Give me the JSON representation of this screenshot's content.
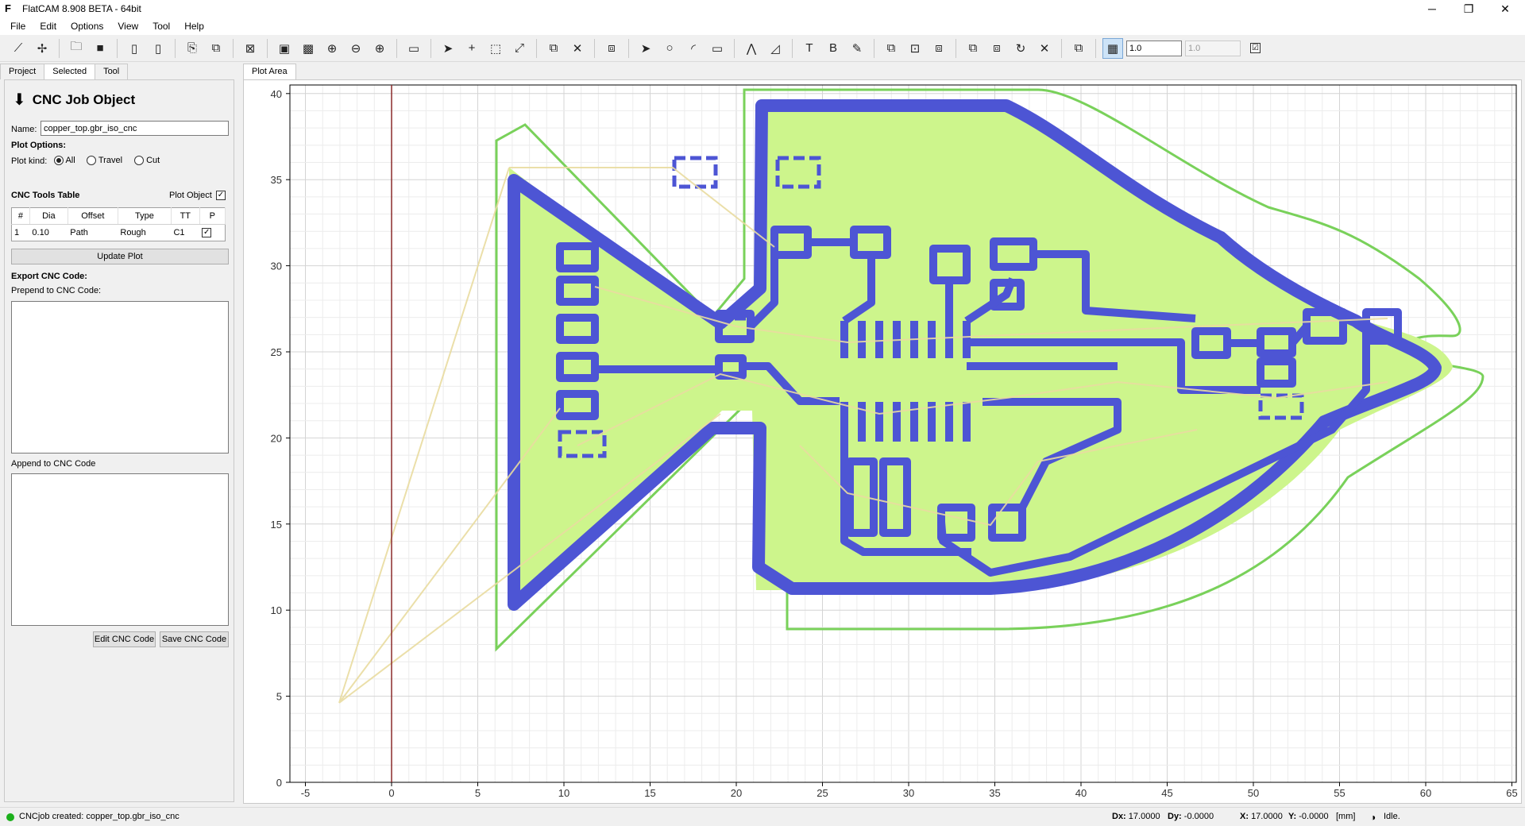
{
  "window": {
    "title": "FlatCAM 8.908 BETA - 64bit",
    "minimize": "─",
    "restore": "❐",
    "close": "✕"
  },
  "menu": [
    "File",
    "Edit",
    "Options",
    "View",
    "Tool",
    "Help"
  ],
  "toolbar": {
    "icons": [
      "new-geometry-icon",
      "add-point-icon",
      "open-folder-icon",
      "save-icon",
      "open-gerber-icon",
      "open-excellon-icon",
      "copy-icon",
      "delete-object-icon",
      "plot-all-icon",
      "clear-plot-icon",
      "zoom-fit-icon",
      "zoom-out-icon",
      "zoom-in-icon",
      "shell-icon",
      "select-icon",
      "add-icon",
      "bbox-icon",
      "move-icon",
      "duplicate-icon",
      "delete-icon",
      "join-icon",
      "pointer-icon",
      "circle-icon",
      "arc-icon",
      "rectangle-icon",
      "polygon-icon",
      "path-icon",
      "text-icon",
      "buffer-icon",
      "paint-icon",
      "union-icon",
      "intersect-icon",
      "subtract-icon",
      "cut-icon",
      "rotate-icon",
      "move-geo-icon",
      "delete-shape-icon",
      "copy-shape-icon",
      "grid-snap-icon"
    ],
    "grid_x": "1.0",
    "grid_y": "1.0",
    "snap_checked": "☑"
  },
  "tabs": [
    "Project",
    "Selected",
    "Tool"
  ],
  "panel": {
    "header": "CNC Job Object",
    "name_label": "Name:",
    "name_value": "copper_top.gbr_iso_cnc",
    "plot_options": "Plot Options:",
    "plot_kind_label": "Plot kind:",
    "plot_kinds": [
      "All",
      "Travel",
      "Cut"
    ],
    "tools_table_label": "CNC Tools Table",
    "plot_object_label": "Plot Object",
    "table_headers": [
      "#",
      "Dia",
      "Offset",
      "Type",
      "TT",
      "P"
    ],
    "table_rows": [
      [
        "1",
        "0.10",
        "Path",
        "Rough",
        "C1"
      ]
    ],
    "update_plot": "Update Plot",
    "export_label": "Export CNC Code:",
    "prepend_label": "Prepend to CNC Code:",
    "append_label": "Append to CNC Code",
    "edit_btn": "Edit CNC Code",
    "save_btn": "Save CNC Code"
  },
  "plot": {
    "tab": "Plot Area",
    "x_ticks": [
      "-5",
      "0",
      "5",
      "10",
      "15",
      "20",
      "25",
      "30",
      "35",
      "40",
      "45",
      "50",
      "55",
      "60",
      "65"
    ],
    "y_ticks": [
      "0",
      "5",
      "10",
      "15",
      "20",
      "25",
      "30",
      "35",
      "40"
    ],
    "colors": {
      "fill": "#cdf58c",
      "outline": "#79d15a",
      "trace": "#4d55d4",
      "travel": "#e9dca0",
      "axis": "#8a2a2a"
    }
  },
  "status": {
    "message": "CNCjob created: copper_top.gbr_iso_cnc",
    "dx_label": "Dx:",
    "dx": "17.0000",
    "dy_label": "Dy:",
    "dy": "-0.0000",
    "x_label": "X:",
    "x": "17.0000",
    "y_label": "Y:",
    "y": "-0.0000",
    "units": "[mm]",
    "state": "Idle."
  }
}
